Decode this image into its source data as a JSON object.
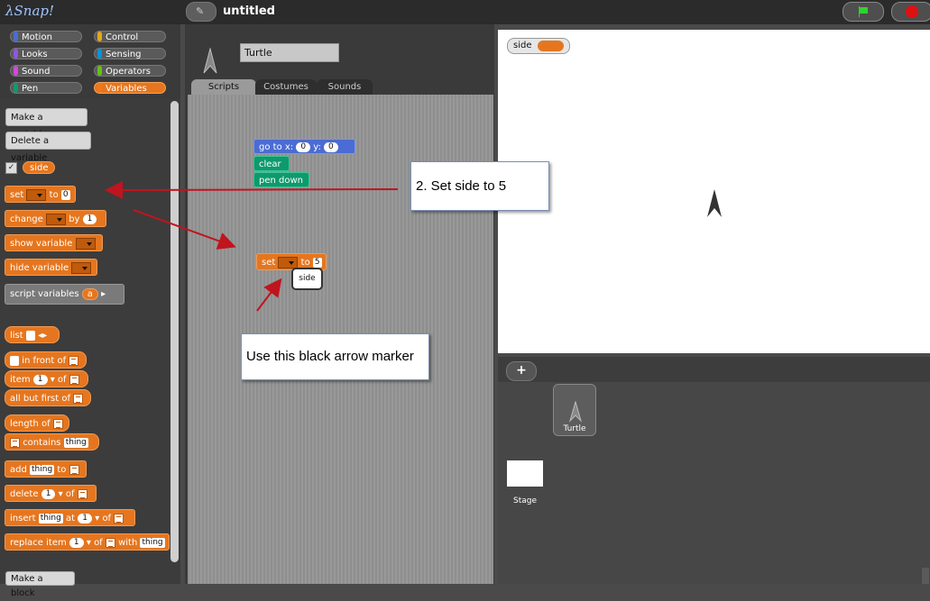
{
  "topbar": {
    "logo": "λSnap!",
    "project_title": "untitled"
  },
  "categories": [
    {
      "label": "Motion",
      "color": "#4a6cd4"
    },
    {
      "label": "Control",
      "color": "#e1a91a"
    },
    {
      "label": "Looks",
      "color": "#8f56e3"
    },
    {
      "label": "Sensing",
      "color": "#0494dc"
    },
    {
      "label": "Sound",
      "color": "#cf4ad9"
    },
    {
      "label": "Operators",
      "color": "#62c213"
    },
    {
      "label": "Pen",
      "color": "#0e9a6c"
    },
    {
      "label": "Variables",
      "color": "#f3761d",
      "selected": true
    }
  ],
  "palette": {
    "make_variable": "Make a variable",
    "delete_variable": "Delete a variable",
    "var_name": "side",
    "set_word": "set",
    "to_word": "to",
    "set_value": "0",
    "change_word": "change",
    "by_word": "by",
    "change_value": "1",
    "show_variable": "show variable",
    "hide_variable": "hide variable",
    "script_variables": "script variables",
    "script_var_name": "a",
    "list_word": "list",
    "in_front_of": "in front of",
    "item_word": "item",
    "item_value": "1",
    "of_word": "of",
    "all_but_first_of": "all but first of",
    "length_of": "length of",
    "contains_word": "contains",
    "thing": "thing",
    "add_word": "add",
    "delete_word": "delete",
    "insert_word": "insert",
    "at_word": "at",
    "replace_item": "replace item",
    "with_word": "with",
    "make_block": "Make a block"
  },
  "sprite": {
    "name": "Turtle",
    "tabs": [
      "Scripts",
      "Costumes",
      "Sounds"
    ]
  },
  "script": {
    "go_to_x": "go to x:",
    "x_value": "0",
    "y_label": "y:",
    "y_value": "0",
    "clear": "clear",
    "pen_down": "pen down",
    "set_word": "set",
    "to_word": "to",
    "set_value": "5",
    "dropdown_tooltip": "side"
  },
  "stage": {
    "watcher_label": "side"
  },
  "corral": {
    "add_label": "+",
    "sprite_label": "Turtle",
    "stage_label": "Stage"
  },
  "annotations": {
    "step2": "2. Set side to 5",
    "marker_hint": "Use this black arrow marker",
    "arrow_color": "#c0141e"
  }
}
